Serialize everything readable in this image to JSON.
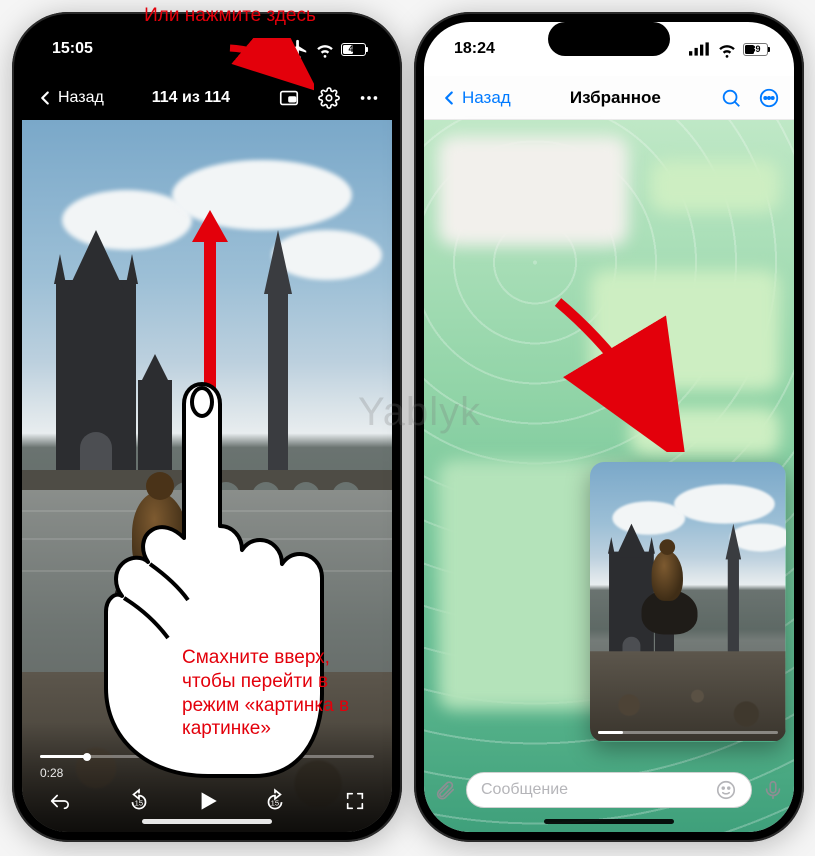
{
  "annotations": {
    "top": "Или нажмите здесь",
    "bottom": "Смахните вверх, чтобы перейти в режим «картинка в картинке»"
  },
  "watermark": "Yablyk",
  "left_phone": {
    "status": {
      "time": "15:05",
      "battery": "44"
    },
    "nav": {
      "back": "Назад",
      "title": "114 из 114"
    },
    "player": {
      "elapsed": "0:28"
    }
  },
  "right_phone": {
    "status": {
      "time": "18:24",
      "battery": "39"
    },
    "nav": {
      "back": "Назад",
      "title": "Избранное"
    },
    "input": {
      "placeholder": "Сообщение"
    }
  }
}
